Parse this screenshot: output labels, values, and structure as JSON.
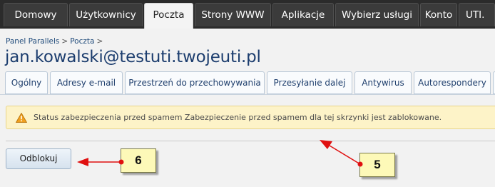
{
  "topnav": {
    "tabs": [
      {
        "label": "Domowy"
      },
      {
        "label": "Użytkownicy"
      },
      {
        "label": "Poczta"
      },
      {
        "label": "Strony WWW"
      },
      {
        "label": "Aplikacje"
      },
      {
        "label": "Wybierz usługi"
      },
      {
        "label": "Konto"
      },
      {
        "label": "UTI."
      }
    ],
    "active": "Poczta"
  },
  "breadcrumb": {
    "items": [
      "Panel Parallels",
      "Poczta"
    ],
    "separator": ">"
  },
  "page_title": "jan.kowalski@testuti.twojeuti.pl",
  "subtabs": [
    {
      "label": "Ogólny"
    },
    {
      "label": "Adresy e-mail"
    },
    {
      "label": "Przestrzeń do przechowywania"
    },
    {
      "label": "Przesyłanie dalej"
    },
    {
      "label": "Antywirus"
    },
    {
      "label": "Autorespondery"
    }
  ],
  "warning": {
    "icon": "warning-triangle-icon",
    "text": "Status zabezpieczenia przed spamem Zabezpieczenie przed spamem dla tej skrzynki jest zablokowane."
  },
  "unlock_button": {
    "label": "Odblokuj"
  },
  "callouts": [
    {
      "label": "6"
    },
    {
      "label": "5"
    }
  ],
  "colors": {
    "nav_bg": "#2b2b2b",
    "title": "#1c3d6e",
    "warning_bg": "#fdf3c8",
    "arrow": "#e01010"
  }
}
